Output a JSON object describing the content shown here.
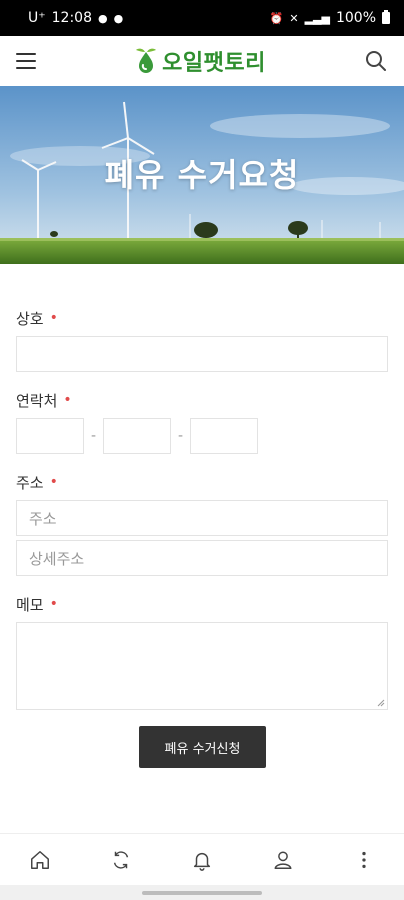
{
  "status": {
    "time": "12:08",
    "carrier": "U⁺",
    "battery": "100%"
  },
  "header": {
    "brand": "오일팻토리"
  },
  "hero": {
    "title": "폐유 수거요청"
  },
  "form": {
    "company": {
      "label": "상호",
      "required_mark": "•",
      "value": ""
    },
    "phone": {
      "label": "연락처",
      "required_mark": "•",
      "separator": "-"
    },
    "address": {
      "label": "주소",
      "required_mark": "•",
      "placeholder": "주소",
      "detail_placeholder": "상세주소"
    },
    "memo": {
      "label": "메모",
      "required_mark": "•"
    },
    "submit_label": "폐유 수거신청"
  },
  "bottom_nav": {
    "icons": [
      "home-icon",
      "refresh-icon",
      "bell-icon",
      "user-icon",
      "more-icon"
    ]
  },
  "colors": {
    "brand_green": "#2f8f2f",
    "required_red": "#e14b4b",
    "button_bg": "#333333"
  }
}
